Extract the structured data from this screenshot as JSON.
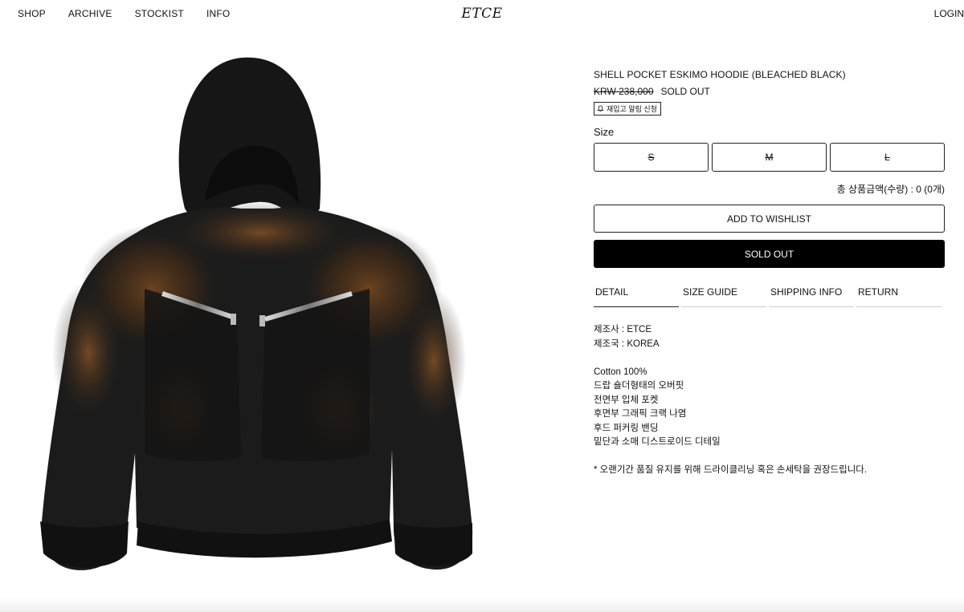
{
  "nav": {
    "items": [
      "SHOP",
      "ARCHIVE",
      "STOCKIST",
      "INFO"
    ],
    "logo": "ETCE",
    "login": "LOGIN"
  },
  "product": {
    "image_alt": "black bleached hoodie with zip pockets",
    "title": "SHELL POCKET ESKIMO HOODIE (BLEACHED BLACK)",
    "price": "KRW 238,000",
    "status": "SOLD OUT",
    "restock_label": "재입고 알림 신청",
    "size_label": "Size",
    "sizes": [
      "S",
      "M",
      "L"
    ],
    "total": "총 상품금액(수량) : 0 (0개)",
    "wishlist_label": "ADD TO WISHLIST",
    "soldout_label": "SOLD OUT"
  },
  "tabs": [
    "DETAIL",
    "SIZE GUIDE",
    "SHIPPING INFO",
    "RETURN"
  ],
  "detail": {
    "maker": "제조사 : ETCE",
    "country": "제조국 : KOREA",
    "lines": [
      "Cotton 100%",
      "드랍 숄더형태의 오버핏",
      "전면부 입체 포켓",
      "후면부 그래픽 크랙 나염",
      "후드 퍼커링 밴딩",
      "밑단과 소매 디스트로이드 디테일"
    ],
    "note": "* 오랜기간 품질 유지를 위해 드라이클리닝 혹은 손세탁을 권장드립니다."
  },
  "colors": {
    "primary": "#000000",
    "border": "#222222"
  }
}
